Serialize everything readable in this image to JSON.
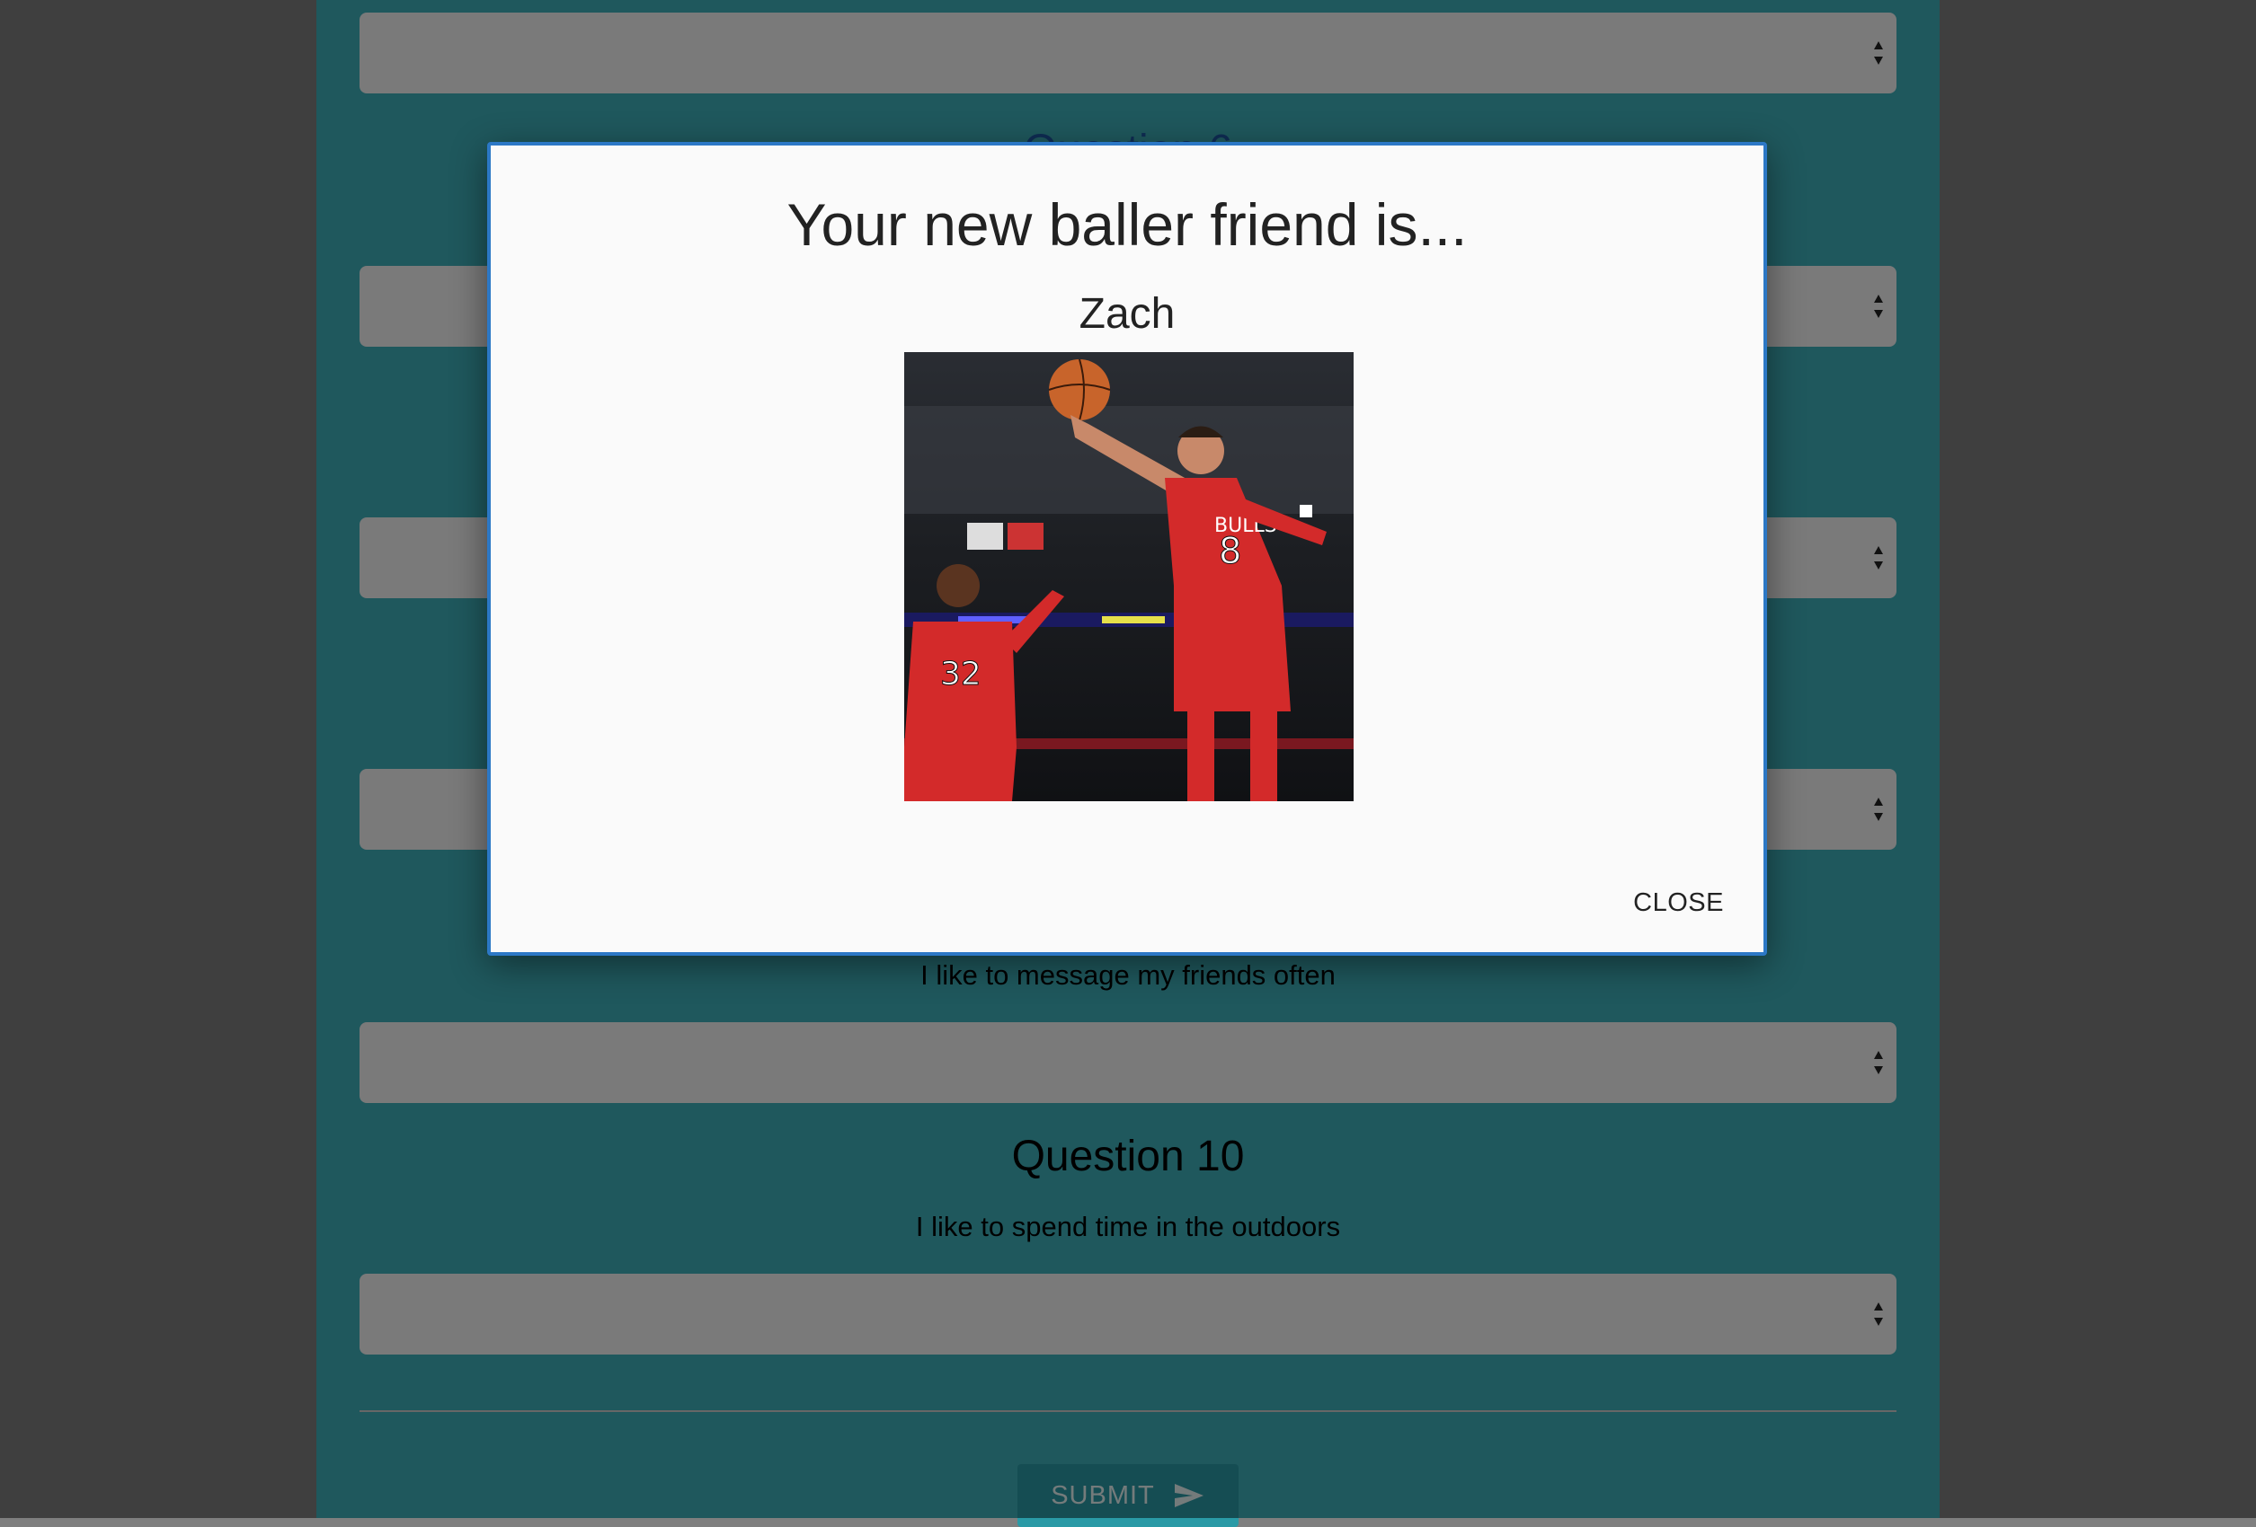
{
  "page": {
    "background_color": "#7f7f7f",
    "panel_color": "#3fb0bb"
  },
  "form": {
    "partially_visible_title": "Question 6",
    "questions": [
      {
        "title": "",
        "text": "I like to message my friends often"
      },
      {
        "title": "Question 10",
        "text": "I like to spend time in the outdoors"
      }
    ],
    "selects": [
      {
        "value": ""
      },
      {
        "value": ""
      },
      {
        "value": ""
      },
      {
        "value": ""
      },
      {
        "value": ""
      },
      {
        "value": ""
      }
    ],
    "submit_label": "SUBMIT",
    "submit_icon": "send-icon"
  },
  "modal": {
    "title": "Your new baller friend is...",
    "friend_name": "Zach",
    "photo_alt": "Zach",
    "close_label": "CLOSE",
    "border_color": "#2c78c6"
  }
}
